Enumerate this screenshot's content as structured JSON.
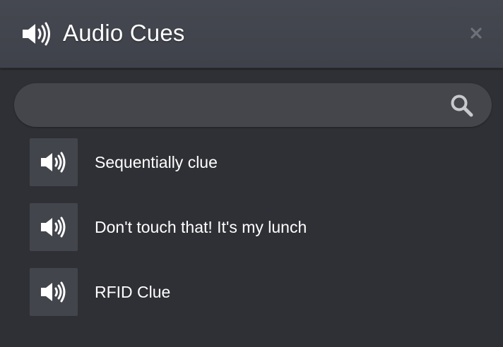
{
  "header": {
    "title": "Audio Cues",
    "icon": "volume-high-icon",
    "close_icon": "close-icon"
  },
  "search": {
    "value": "",
    "placeholder": "",
    "icon": "search-icon"
  },
  "cues": [
    {
      "label": "Sequentially clue",
      "icon": "volume-high-icon"
    },
    {
      "label": "Don't touch that! It's my lunch",
      "icon": "volume-high-icon"
    },
    {
      "label": "RFID Clue",
      "icon": "volume-high-icon"
    }
  ],
  "colors": {
    "background": "#2f3035",
    "header": "#42454c",
    "search_bg": "#44464c",
    "tile_bg": "#42454c",
    "text": "#ffffff",
    "close_icon": "#6e7178",
    "search_icon": "#c8c9cc"
  }
}
